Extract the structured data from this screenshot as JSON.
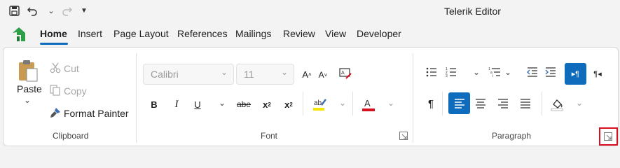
{
  "app": {
    "title": "Telerik Editor"
  },
  "tabs": [
    {
      "label": "Home"
    },
    {
      "label": "Insert"
    },
    {
      "label": "Page Layout"
    },
    {
      "label": "References"
    },
    {
      "label": "Mailings"
    },
    {
      "label": "Review"
    },
    {
      "label": "View"
    },
    {
      "label": "Developer"
    }
  ],
  "clipboard": {
    "paste_label": "Paste",
    "cut_label": "Cut",
    "copy_label": "Copy",
    "format_painter_label": "Format Painter",
    "group_label": "Clipboard"
  },
  "font": {
    "family_value": "Calibri",
    "size_value": "11",
    "group_label": "Font"
  },
  "paragraph": {
    "group_label": "Paragraph"
  },
  "colors": {
    "accent": "#0f6cbd",
    "highlight_yellow": "#f3e600",
    "font_red": "#d7101f",
    "logo_green": "#2e9e49"
  }
}
